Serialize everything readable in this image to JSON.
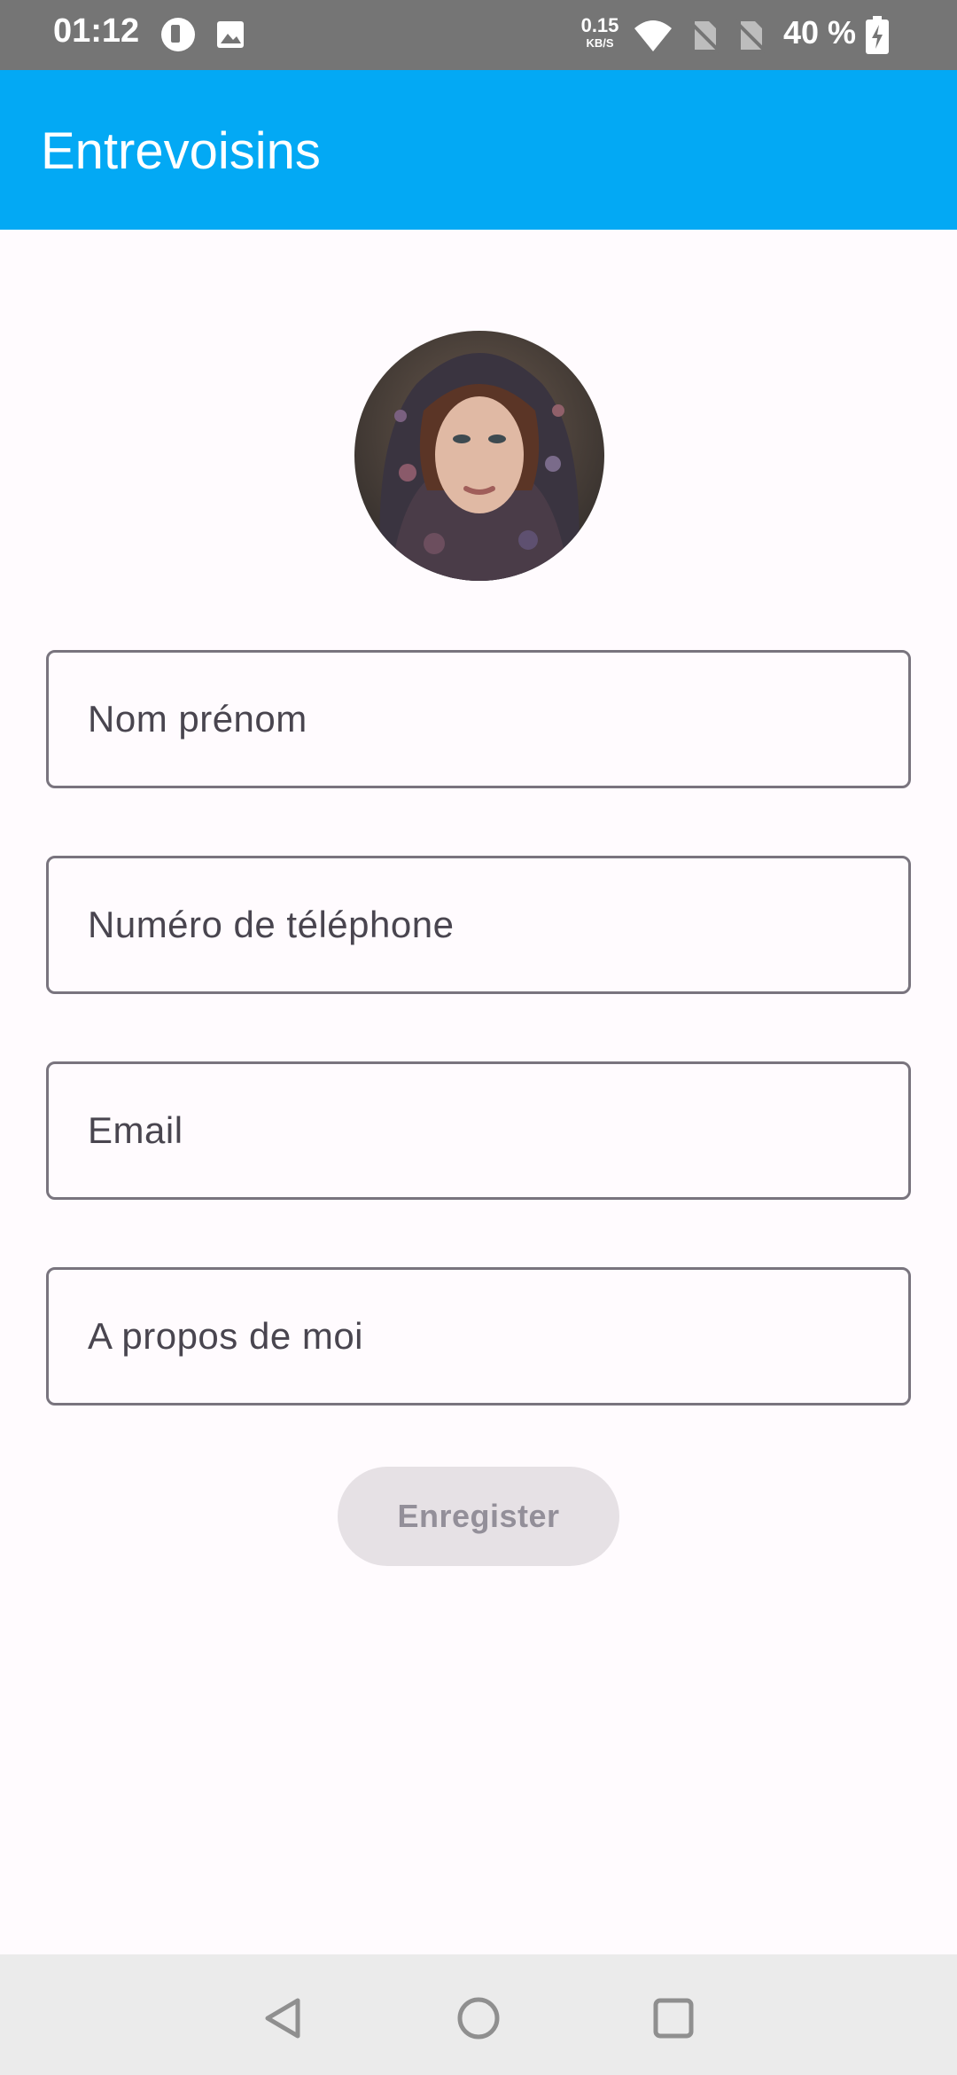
{
  "status_bar": {
    "time": "01:12",
    "net_speed_value": "0.15",
    "net_speed_unit": "KB/S",
    "battery_percent": "40 %",
    "icons": [
      "app-notification-icon",
      "image-icon",
      "wifi-icon",
      "no-sim-icon",
      "no-sim-icon",
      "battery-charging-icon"
    ]
  },
  "app_bar": {
    "title": "Entrevoisins",
    "color": "#03a9f4"
  },
  "profile": {
    "avatar": "profile-photo"
  },
  "form": {
    "name_placeholder": "Nom prénom",
    "phone_placeholder": "Numéro de téléphone",
    "email_placeholder": "Email",
    "about_placeholder": "A propos de moi",
    "save_label": "Enregister",
    "save_enabled": false
  },
  "nav_bar": {
    "icons": [
      "back-icon",
      "home-icon",
      "recents-icon"
    ]
  }
}
